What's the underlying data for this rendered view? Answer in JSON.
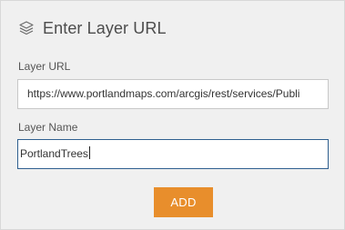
{
  "header": {
    "icon": "layers-icon",
    "title": "Enter Layer URL"
  },
  "form": {
    "url_label": "Layer URL",
    "url_value": "https://www.portlandmaps.com/arcgis/rest/services/Publi",
    "name_label": "Layer Name",
    "name_value": "PortlandTrees"
  },
  "actions": {
    "add_label": "ADD",
    "add_color": "#e88e2c"
  }
}
